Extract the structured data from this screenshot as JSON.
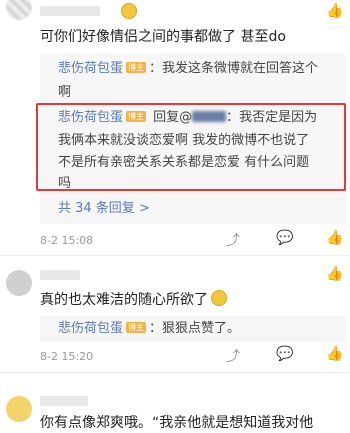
{
  "comments": [
    {
      "text": "可你们好像情侣之间的事都做了 甚至do",
      "replies": [
        {
          "name": "悲伤荷包蛋",
          "badge": "博主",
          "lines": [
            "：我发这条微博就在回答这个",
            "啊"
          ]
        },
        {
          "name": "悲伤荷包蛋",
          "badge": "博主",
          "lines": [
            " 回复@",
            "：我否定是因为",
            "我俩本来就没谈恋爱啊 我发的微博不也说了",
            "不是所有亲密关系关系都是恋爱 有什么问题",
            "吗"
          ]
        }
      ],
      "more_replies": "共 34 条回复 >",
      "time": "8-2 15:08"
    },
    {
      "text": "真的也太难洁的随心所欲了",
      "replies": [
        {
          "name": "悲伤荷包蛋",
          "badge": "博主",
          "lines": [
            "：狠狠点赞了。"
          ]
        }
      ],
      "time": "8-2 15:20"
    },
    {
      "text": "你有点像郑爽哦。“我亲他就是想知道我对他"
    }
  ]
}
